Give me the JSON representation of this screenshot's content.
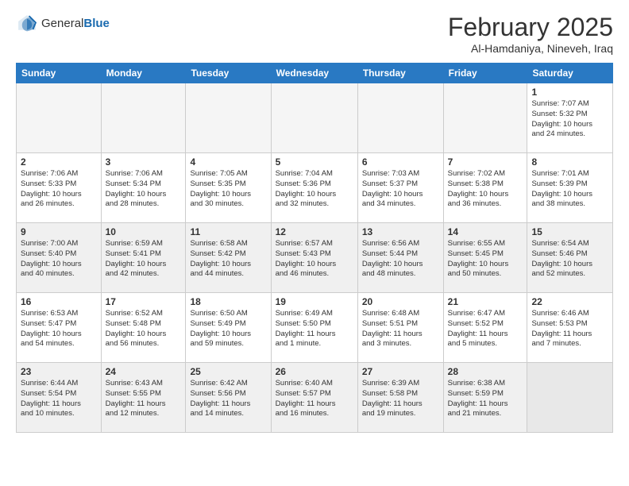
{
  "header": {
    "logo": {
      "general": "General",
      "blue": "Blue"
    },
    "title": "February 2025",
    "location": "Al-Hamdaniya, Nineveh, Iraq"
  },
  "days_of_week": [
    "Sunday",
    "Monday",
    "Tuesday",
    "Wednesday",
    "Thursday",
    "Friday",
    "Saturday"
  ],
  "weeks": [
    [
      {
        "day": "",
        "info": ""
      },
      {
        "day": "",
        "info": ""
      },
      {
        "day": "",
        "info": ""
      },
      {
        "day": "",
        "info": ""
      },
      {
        "day": "",
        "info": ""
      },
      {
        "day": "",
        "info": ""
      },
      {
        "day": "1",
        "info": "Sunrise: 7:07 AM\nSunset: 5:32 PM\nDaylight: 10 hours\nand 24 minutes."
      }
    ],
    [
      {
        "day": "2",
        "info": "Sunrise: 7:06 AM\nSunset: 5:33 PM\nDaylight: 10 hours\nand 26 minutes."
      },
      {
        "day": "3",
        "info": "Sunrise: 7:06 AM\nSunset: 5:34 PM\nDaylight: 10 hours\nand 28 minutes."
      },
      {
        "day": "4",
        "info": "Sunrise: 7:05 AM\nSunset: 5:35 PM\nDaylight: 10 hours\nand 30 minutes."
      },
      {
        "day": "5",
        "info": "Sunrise: 7:04 AM\nSunset: 5:36 PM\nDaylight: 10 hours\nand 32 minutes."
      },
      {
        "day": "6",
        "info": "Sunrise: 7:03 AM\nSunset: 5:37 PM\nDaylight: 10 hours\nand 34 minutes."
      },
      {
        "day": "7",
        "info": "Sunrise: 7:02 AM\nSunset: 5:38 PM\nDaylight: 10 hours\nand 36 minutes."
      },
      {
        "day": "8",
        "info": "Sunrise: 7:01 AM\nSunset: 5:39 PM\nDaylight: 10 hours\nand 38 minutes."
      }
    ],
    [
      {
        "day": "9",
        "info": "Sunrise: 7:00 AM\nSunset: 5:40 PM\nDaylight: 10 hours\nand 40 minutes."
      },
      {
        "day": "10",
        "info": "Sunrise: 6:59 AM\nSunset: 5:41 PM\nDaylight: 10 hours\nand 42 minutes."
      },
      {
        "day": "11",
        "info": "Sunrise: 6:58 AM\nSunset: 5:42 PM\nDaylight: 10 hours\nand 44 minutes."
      },
      {
        "day": "12",
        "info": "Sunrise: 6:57 AM\nSunset: 5:43 PM\nDaylight: 10 hours\nand 46 minutes."
      },
      {
        "day": "13",
        "info": "Sunrise: 6:56 AM\nSunset: 5:44 PM\nDaylight: 10 hours\nand 48 minutes."
      },
      {
        "day": "14",
        "info": "Sunrise: 6:55 AM\nSunset: 5:45 PM\nDaylight: 10 hours\nand 50 minutes."
      },
      {
        "day": "15",
        "info": "Sunrise: 6:54 AM\nSunset: 5:46 PM\nDaylight: 10 hours\nand 52 minutes."
      }
    ],
    [
      {
        "day": "16",
        "info": "Sunrise: 6:53 AM\nSunset: 5:47 PM\nDaylight: 10 hours\nand 54 minutes."
      },
      {
        "day": "17",
        "info": "Sunrise: 6:52 AM\nSunset: 5:48 PM\nDaylight: 10 hours\nand 56 minutes."
      },
      {
        "day": "18",
        "info": "Sunrise: 6:50 AM\nSunset: 5:49 PM\nDaylight: 10 hours\nand 59 minutes."
      },
      {
        "day": "19",
        "info": "Sunrise: 6:49 AM\nSunset: 5:50 PM\nDaylight: 11 hours\nand 1 minute."
      },
      {
        "day": "20",
        "info": "Sunrise: 6:48 AM\nSunset: 5:51 PM\nDaylight: 11 hours\nand 3 minutes."
      },
      {
        "day": "21",
        "info": "Sunrise: 6:47 AM\nSunset: 5:52 PM\nDaylight: 11 hours\nand 5 minutes."
      },
      {
        "day": "22",
        "info": "Sunrise: 6:46 AM\nSunset: 5:53 PM\nDaylight: 11 hours\nand 7 minutes."
      }
    ],
    [
      {
        "day": "23",
        "info": "Sunrise: 6:44 AM\nSunset: 5:54 PM\nDaylight: 11 hours\nand 10 minutes."
      },
      {
        "day": "24",
        "info": "Sunrise: 6:43 AM\nSunset: 5:55 PM\nDaylight: 11 hours\nand 12 minutes."
      },
      {
        "day": "25",
        "info": "Sunrise: 6:42 AM\nSunset: 5:56 PM\nDaylight: 11 hours\nand 14 minutes."
      },
      {
        "day": "26",
        "info": "Sunrise: 6:40 AM\nSunset: 5:57 PM\nDaylight: 11 hours\nand 16 minutes."
      },
      {
        "day": "27",
        "info": "Sunrise: 6:39 AM\nSunset: 5:58 PM\nDaylight: 11 hours\nand 19 minutes."
      },
      {
        "day": "28",
        "info": "Sunrise: 6:38 AM\nSunset: 5:59 PM\nDaylight: 11 hours\nand 21 minutes."
      },
      {
        "day": "",
        "info": ""
      }
    ]
  ]
}
